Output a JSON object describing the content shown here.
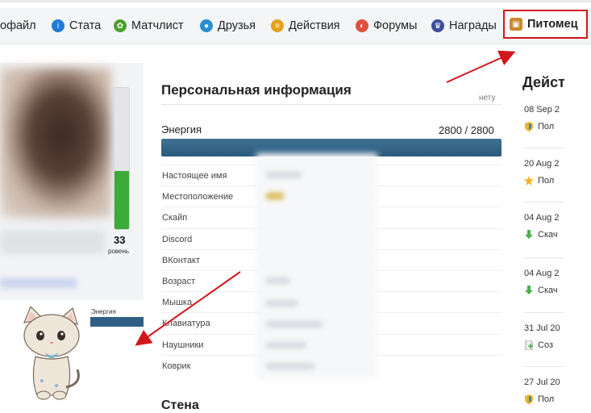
{
  "nav": {
    "tabs": [
      {
        "label": "офайл",
        "icon": "none",
        "active": false
      },
      {
        "label": "Стата",
        "icon": "info-icon",
        "color": "#1e7bd6",
        "active": false
      },
      {
        "label": "Матчлист",
        "icon": "radiation-icon",
        "color": "#4aa02c",
        "active": false
      },
      {
        "label": "Друзья",
        "icon": "users-icon",
        "color": "#2a8fd0",
        "active": false
      },
      {
        "label": "Действия",
        "icon": "list-icon",
        "color": "#e3a21a",
        "active": false
      },
      {
        "label": "Форумы",
        "icon": "forum-icon",
        "color": "#e0503a",
        "active": false
      },
      {
        "label": "Награды",
        "icon": "trophy-icon",
        "color": "#3d4f9c",
        "active": false
      },
      {
        "label": "Питомец",
        "icon": "pet-icon",
        "color": "#c9892f",
        "active": true
      }
    ]
  },
  "profile": {
    "level_number": "33",
    "level_label": "ровень",
    "level_fill_fraction": 0.41,
    "pet_energy_label": "Энергия"
  },
  "personal": {
    "title": "Персональная информация",
    "no_data": "нету",
    "energy_label": "Энергия",
    "energy_value": "2800 / 2800",
    "rows": [
      "Настоящее имя",
      "Местоположение",
      "Скайп",
      "Discord",
      "ВКонтакт",
      "Возраст",
      "Мышка",
      "Клавиатура",
      "Наушники",
      "Коврик"
    ]
  },
  "wall": {
    "title": "Стена"
  },
  "actions": {
    "title": "Дейст",
    "entries": [
      {
        "date": "08 Sep 2",
        "text": "Пол",
        "icon": "shield-icon"
      },
      {
        "date": "20 Aug 2",
        "text": "Пол",
        "icon": "medal-icon"
      },
      {
        "date": "04 Aug 2",
        "text": "Скач",
        "icon": "download-icon"
      },
      {
        "date": "04 Aug 2",
        "text": "Скач",
        "icon": "download-icon"
      },
      {
        "date": "31 Jul 20",
        "text": "Соз",
        "icon": "file-icon"
      },
      {
        "date": "27 Jul 20",
        "text": "Пол",
        "icon": "shield-icon"
      }
    ]
  },
  "colors": {
    "accent_red": "#d3161b",
    "energy_bar": "#2f5f84",
    "level_green": "#3dab3a"
  }
}
